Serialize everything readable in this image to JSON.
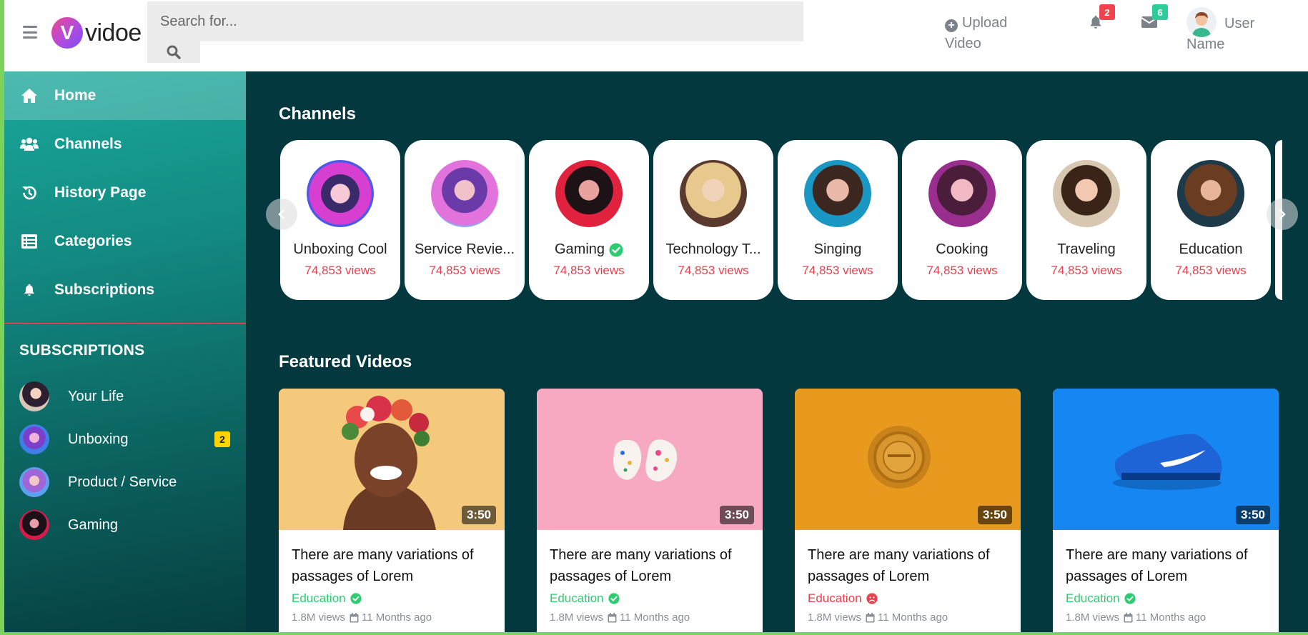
{
  "header": {
    "menu_icon": "hamburger-icon",
    "logo_letter": "V",
    "logo_text": "vidoe",
    "search_placeholder": "Search for...",
    "upload_label": "Upload Video",
    "notifications_count": "2",
    "messages_count": "6",
    "user_name": "User Name",
    "colors": {
      "notif_badge": "#f0434d",
      "msg_badge": "#2ecc9a"
    }
  },
  "sidebar": {
    "nav": [
      {
        "label": "Home",
        "icon": "home-icon",
        "active": true
      },
      {
        "label": "Channels",
        "icon": "users-icon"
      },
      {
        "label": "History Page",
        "icon": "history-icon"
      },
      {
        "label": "Categories",
        "icon": "list-icon"
      },
      {
        "label": "Subscriptions",
        "icon": "bell-icon"
      }
    ],
    "subscriptions_heading": "SUBSCRIPTIONS",
    "subscriptions": [
      {
        "label": "Your Life"
      },
      {
        "label": "Unboxing",
        "badge": "2"
      },
      {
        "label": "Product / Service"
      },
      {
        "label": "Gaming"
      }
    ]
  },
  "channels": {
    "title": "Channels",
    "items": [
      {
        "name": "Unboxing Cool",
        "views": "74,853 views"
      },
      {
        "name": "Service Revie...",
        "views": "74,853 views"
      },
      {
        "name": "Gaming",
        "views": "74,853 views",
        "verified": true
      },
      {
        "name": "Technology T...",
        "views": "74,853 views"
      },
      {
        "name": "Singing",
        "views": "74,853 views"
      },
      {
        "name": "Cooking",
        "views": "74,853 views"
      },
      {
        "name": "Traveling",
        "views": "74,853 views"
      },
      {
        "name": "Education",
        "views": "74,853 views"
      }
    ]
  },
  "featured": {
    "title": "Featured Videos",
    "videos": [
      {
        "duration": "3:50",
        "title": "There are many variations of passages of Lorem",
        "category": "Education",
        "status": "verified",
        "views": "1.8M views",
        "date": "11 Months ago"
      },
      {
        "duration": "3:50",
        "title": "There are many variations of passages of Lorem",
        "category": "Education",
        "status": "verified",
        "views": "1.8M views",
        "date": "11 Months ago"
      },
      {
        "duration": "3:50",
        "title": "There are many variations of passages of Lorem",
        "category": "Education",
        "status": "sad",
        "views": "1.8M views",
        "date": "11 Months ago"
      },
      {
        "duration": "3:50",
        "title": "There are many variations of passages of Lorem",
        "category": "Education",
        "status": "verified",
        "views": "1.8M views",
        "date": "11 Months ago"
      }
    ],
    "colors": {
      "verified": "#2ecc71",
      "sad": "#e8404e"
    }
  }
}
